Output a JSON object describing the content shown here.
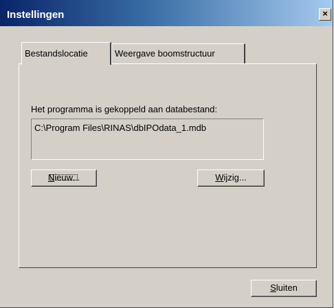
{
  "window": {
    "title": "Instellingen",
    "close_glyph": "×"
  },
  "tabs": [
    {
      "label": "Bestandslocatie",
      "active": true
    },
    {
      "label": "Weergave boomstructuur",
      "active": false
    }
  ],
  "database": {
    "label": "Het programma is gekoppeld aan databestand:",
    "path": "C:\\Program Files\\RINAS\\dbIPOdata_1.mdb"
  },
  "buttons": {
    "new": {
      "mnemonic": "N",
      "rest": "ieuw..."
    },
    "change": {
      "mnemonic": "W",
      "rest": "ijzig..."
    },
    "close": {
      "mnemonic": "S",
      "rest": "luiten"
    }
  },
  "colors": {
    "face": "#d4d0c8",
    "title_start": "#0a246a",
    "title_end": "#a6caf0"
  }
}
